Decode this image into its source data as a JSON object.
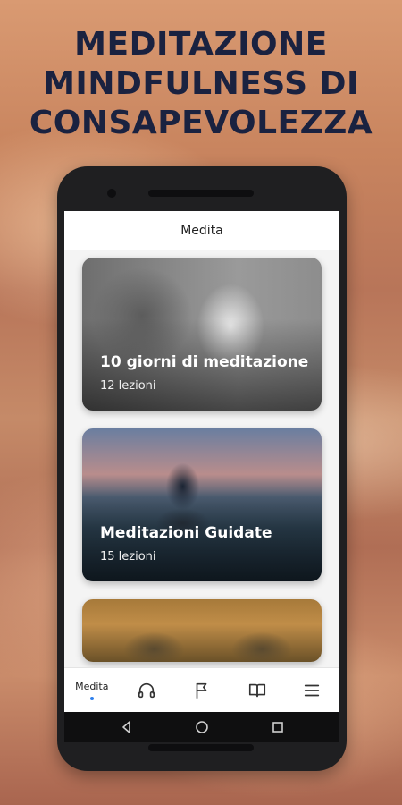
{
  "headline": {
    "line1": "MEDITAZIONE",
    "line2": "MINDFULNESS DI",
    "line3": "CONSAPEVOLEZZA"
  },
  "app": {
    "title": "Medita",
    "cards": [
      {
        "title": "10 giorni di meditazione",
        "subtitle": "12 lezioni"
      },
      {
        "title": "Meditazioni Guidate",
        "subtitle": "15 lezioni"
      },
      {
        "title": "",
        "subtitle": ""
      }
    ],
    "tabs": [
      {
        "label": "Medita",
        "icon": "meditate",
        "active": true
      },
      {
        "label": "",
        "icon": "headphones-icon"
      },
      {
        "label": "",
        "icon": "flag-icon"
      },
      {
        "label": "",
        "icon": "book-icon"
      },
      {
        "label": "",
        "icon": "menu-icon"
      }
    ],
    "nav": [
      "back-icon",
      "home-icon",
      "recents-icon"
    ]
  },
  "colors": {
    "headline": "#1a2240",
    "active_dot": "#2f80ed",
    "phone_body": "#1f1f21"
  }
}
